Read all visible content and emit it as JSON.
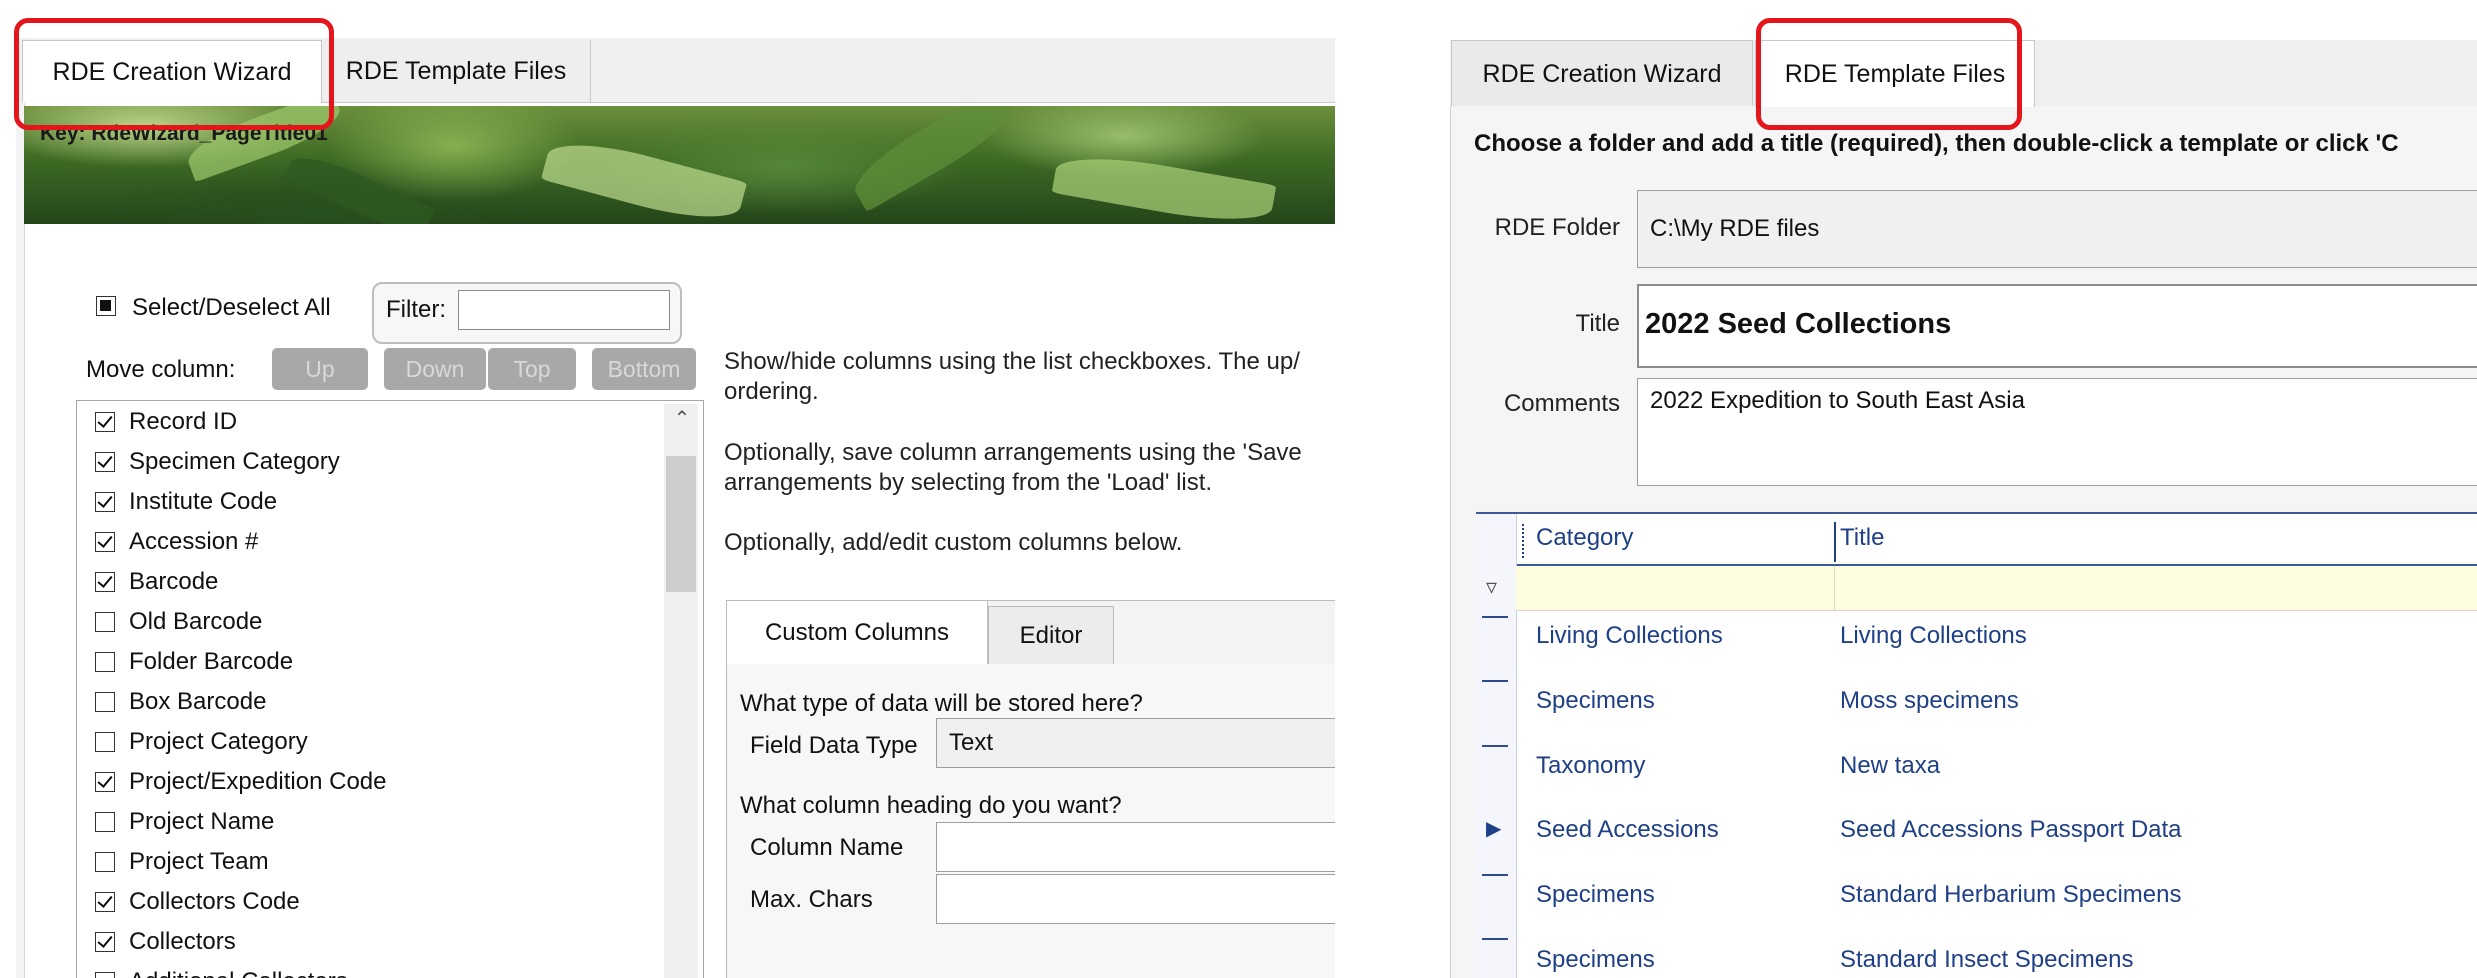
{
  "left_panel": {
    "tabs": [
      {
        "label": "RDE Creation Wizard",
        "active": true
      },
      {
        "label": "RDE Template Files",
        "active": false
      }
    ],
    "banner_text": "Key: RdeWizard_PageTitle01",
    "select_all_label": "Select/Deselect All",
    "filter_label": "Filter:",
    "filter_value": "",
    "move_column_label": "Move column:",
    "move_buttons": [
      "Up",
      "Down",
      "Top",
      "Bottom"
    ],
    "columns": [
      {
        "label": "Record ID",
        "checked": true
      },
      {
        "label": "Specimen Category",
        "checked": true
      },
      {
        "label": "Institute Code",
        "checked": true
      },
      {
        "label": "Accession #",
        "checked": true
      },
      {
        "label": "Barcode",
        "checked": true
      },
      {
        "label": "Old Barcode",
        "checked": false
      },
      {
        "label": "Folder Barcode",
        "checked": false
      },
      {
        "label": "Box Barcode",
        "checked": false
      },
      {
        "label": "Project Category",
        "checked": false
      },
      {
        "label": "Project/Expedition Code",
        "checked": true
      },
      {
        "label": "Project Name",
        "checked": false
      },
      {
        "label": "Project Team",
        "checked": false
      },
      {
        "label": "Collectors Code",
        "checked": true
      },
      {
        "label": "Collectors",
        "checked": true
      },
      {
        "label": "Additional Collectors",
        "checked": false
      }
    ],
    "help": {
      "line1": "Show/hide columns using the list checkboxes. The up/",
      "line2": "ordering.",
      "line3": "Optionally, save column arrangements using the 'Save",
      "line4": "arrangements by selecting from the 'Load' list.",
      "line5": "Optionally, add/edit custom columns below."
    },
    "custom_tabs": [
      {
        "label": "Custom Columns",
        "active": true
      },
      {
        "label": "Editor",
        "active": false
      }
    ],
    "custom": {
      "q1": "What type of data will be stored here?",
      "field_data_type_label": "Field Data Type",
      "field_data_type_value": "Text",
      "q2": "What column heading do you want?",
      "column_name_label": "Column Name",
      "column_name_value": "",
      "max_chars_label": "Max. Chars",
      "max_chars_value": ""
    }
  },
  "right_panel": {
    "tabs": [
      {
        "label": "RDE Creation Wizard",
        "active": false
      },
      {
        "label": "RDE Template Files",
        "active": true
      }
    ],
    "instruction": "Choose a folder and add a title (required), then double-click a template or click 'C",
    "folder_label": "RDE Folder",
    "folder_value": "C:\\My RDE files",
    "title_label": "Title",
    "title_value": "2022 Seed Collections",
    "comments_label": "Comments",
    "comments_value": "2022 Expedition to South East Asia",
    "grid": {
      "headers": [
        "Category",
        "Title"
      ],
      "rows": [
        {
          "category": "Living Collections",
          "title": "Living Collections",
          "current": false
        },
        {
          "category": "Specimens",
          "title": "Moss specimens",
          "current": false
        },
        {
          "category": "Taxonomy",
          "title": "New taxa",
          "current": false
        },
        {
          "category": "Seed Accessions",
          "title": "Seed Accessions Passport Data",
          "current": true
        },
        {
          "category": "Specimens",
          "title": "Standard Herbarium Specimens",
          "current": false
        },
        {
          "category": "Specimens",
          "title": "Standard Insect Specimens",
          "current": false
        }
      ]
    }
  },
  "colors": {
    "highlight_red": "#e3171b",
    "grid_text_blue": "#1f3f86",
    "filter_row_yellow": "#fffde0"
  }
}
